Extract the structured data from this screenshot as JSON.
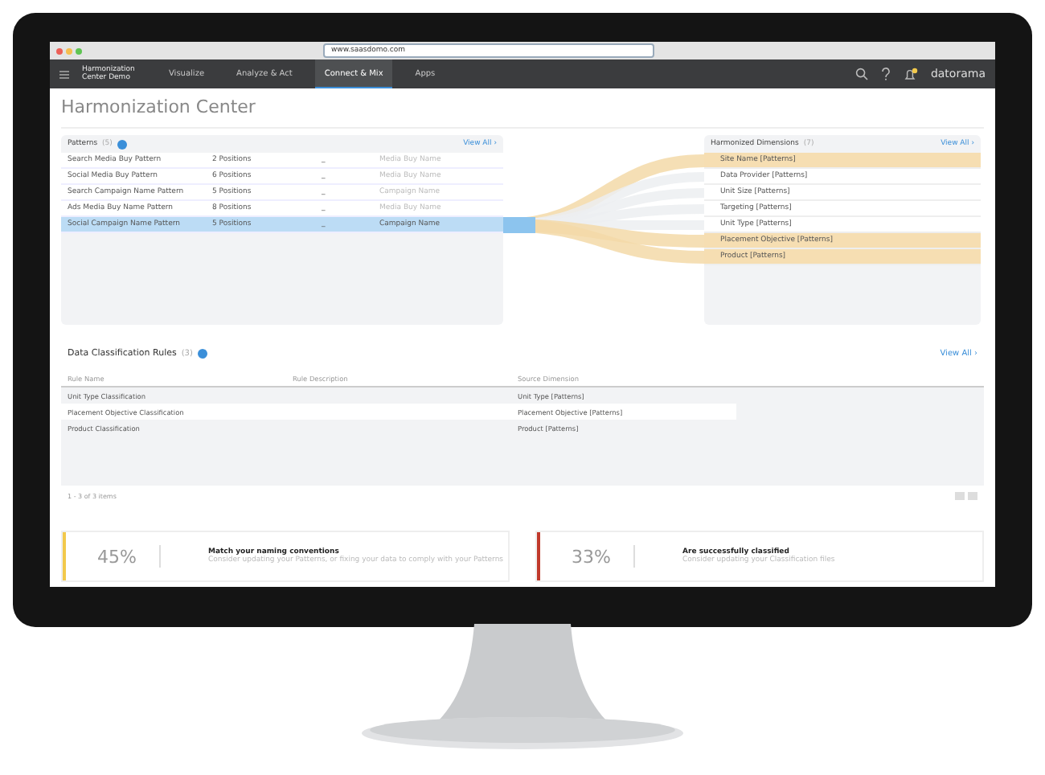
{
  "browser": {
    "url": "www.saasdomo.com"
  },
  "nav": {
    "brand": "Harmonization Center Demo",
    "tabs": [
      {
        "label": "Visualize",
        "selected": false
      },
      {
        "label": "Analyze & Act",
        "selected": false
      },
      {
        "label": "Connect & Mix",
        "selected": true
      },
      {
        "label": "Apps",
        "selected": false
      }
    ],
    "logo": "datorama"
  },
  "page_title": "Harmonization Center",
  "patterns": {
    "title": "Patterns",
    "count": "(5)",
    "view_all": "View All ›",
    "rows": [
      {
        "name": "Search Media Buy Pattern",
        "positions": "2 Positions",
        "column_3": "_",
        "column_4": "Media Buy Name",
        "selected": false
      },
      {
        "name": "Social Media Buy Pattern",
        "positions": "6 Positions",
        "column_3": "_",
        "column_4": "Media Buy Name",
        "selected": false
      },
      {
        "name": "Search Campaign Name Pattern",
        "positions": "5 Positions",
        "column_3": "_",
        "column_4": "Campaign Name",
        "selected": false
      },
      {
        "name": "Ads Media Buy Name Pattern",
        "positions": "8 Positions",
        "column_3": "_",
        "column_4": "Media Buy Name",
        "selected": false
      },
      {
        "name": "Social Campaign Name Pattern",
        "positions": "5 Positions",
        "column_3": "_",
        "column_4": "Campaign Name",
        "selected": true
      }
    ]
  },
  "dimensions": {
    "title": "Harmonized Dimensions",
    "count": "(7)",
    "view_all": "View All ›",
    "items": [
      {
        "label": "Site Name [Patterns]",
        "highlighted": true
      },
      {
        "label": "Data Provider [Patterns]",
        "highlighted": false
      },
      {
        "label": "Unit Size [Patterns]",
        "highlighted": false
      },
      {
        "label": "Targeting [Patterns]",
        "highlighted": false
      },
      {
        "label": "Unit Type [Patterns]",
        "highlighted": false
      },
      {
        "label": "Placement Objective [Patterns]",
        "highlighted": true
      },
      {
        "label": "Product [Patterns]",
        "highlighted": true
      }
    ]
  },
  "rules": {
    "title": "Data Classification Rules",
    "count": "(3)",
    "view_all": "View All ›",
    "columns": [
      "Rule Name",
      "Rule Description",
      "Source Dimension"
    ],
    "rows": [
      {
        "name": "Unit Type Classification",
        "source": "Unit Type [Patterns]"
      },
      {
        "name": "Placement Objective Classification",
        "source": "Placement Objective [Patterns]"
      },
      {
        "name": "Product Classification",
        "source": "Product [Patterns]"
      }
    ],
    "footer": "1 - 3 of 3 items"
  },
  "stats": [
    {
      "value": "45%",
      "color": "#f2c94c",
      "title": "Match your naming conventions",
      "description": "Consider updating your Patterns, or fixing your data to comply with your Patterns"
    },
    {
      "value": "33%",
      "color": "#c0392b",
      "title": "Are successfully classified",
      "description": "Consider updating your Classification files"
    }
  ]
}
